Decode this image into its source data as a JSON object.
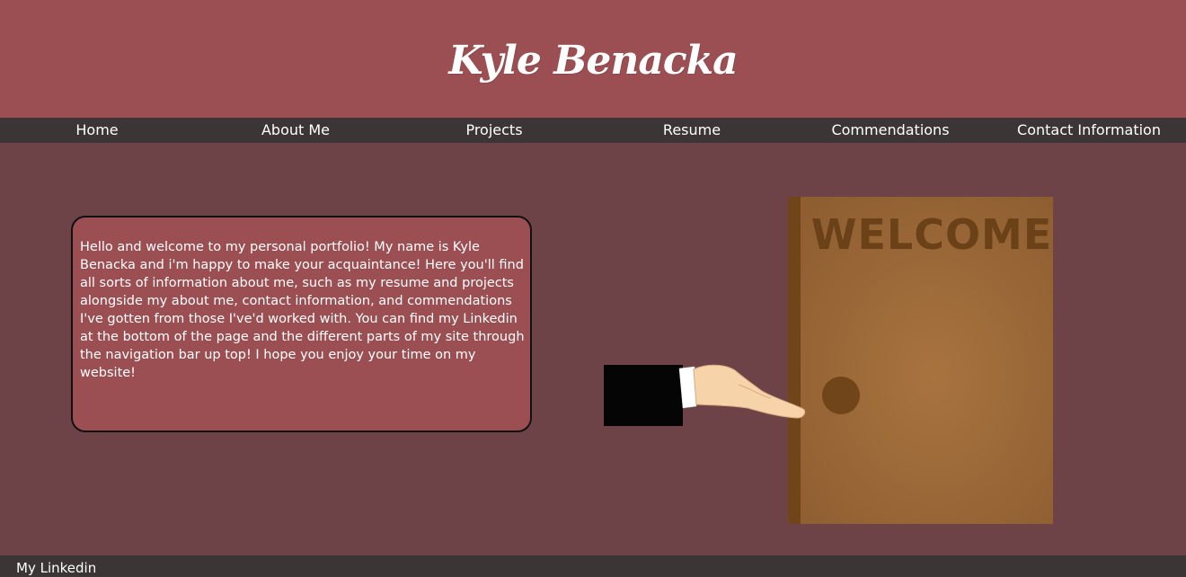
{
  "header": {
    "title": "Kyle Benacka"
  },
  "nav": {
    "items": [
      {
        "label": "Home"
      },
      {
        "label": "About Me"
      },
      {
        "label": "Projects"
      },
      {
        "label": "Resume"
      },
      {
        "label": "Commendations"
      },
      {
        "label": "Contact Information"
      }
    ]
  },
  "intro": {
    "text": "Hello and welcome to my personal portfolio! My name is Kyle Benacka and i'm happy to make your acquaintance! Here you'll find all sorts of information about me, such as my resume and projects alongside my about me, contact information, and commendations I've gotten from those I've'd worked with. You can find my Linkedin at the bottom of the page and the different parts of my site through the navigation bar up top! I hope you enjoy your time on my website!"
  },
  "illustration": {
    "door_sign": "WELCOME",
    "icon": "welcome-door-with-hand-illustration"
  },
  "footer": {
    "link_label": "My Linkedin"
  },
  "colors": {
    "header_bg": "#9b4f52",
    "nav_bg": "#3c3535",
    "page_bg": "#6e4347",
    "text": "#ffffff",
    "door": "#a06c3c",
    "door_edge": "#6f4519"
  }
}
